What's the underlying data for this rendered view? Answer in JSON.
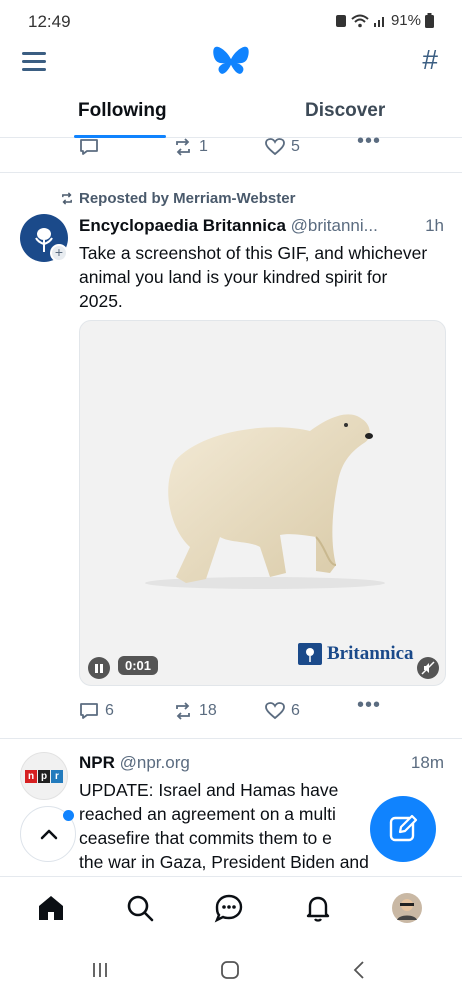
{
  "status_bar": {
    "time": "12:49",
    "battery": "91%"
  },
  "header": {
    "feeds_glyph": "#"
  },
  "tabs": [
    {
      "label": "Following",
      "active": true
    },
    {
      "label": "Discover",
      "active": false
    }
  ],
  "previous_post_actions": {
    "reposts": "1",
    "likes": "5"
  },
  "posts": [
    {
      "reposted_by": "Reposted by Merriam-Webster",
      "author_name": "Encyclopaedia Britannica",
      "author_handle": "@britanni...",
      "time": "1h",
      "text": "Take a screenshot of this GIF, and whichever animal you land is your kindred spirit for 2025.",
      "media": {
        "duration": "0:01",
        "watermark": "Britannica"
      },
      "replies": "6",
      "reposts": "18",
      "likes": "6"
    },
    {
      "author_name": "NPR",
      "author_handle": "@npr.org",
      "time": "18m",
      "avatar_text": "npr",
      "text_lines": [
        "UPDATE: Israel and Hamas have",
        "reached an agreement on a multi",
        "ceasefire that commits them to e",
        "the war in Gaza, President Biden and"
      ]
    }
  ],
  "colors": {
    "accent": "#1083fe",
    "icon_blue": "#3b5e82",
    "muted": "#5b6c80"
  }
}
